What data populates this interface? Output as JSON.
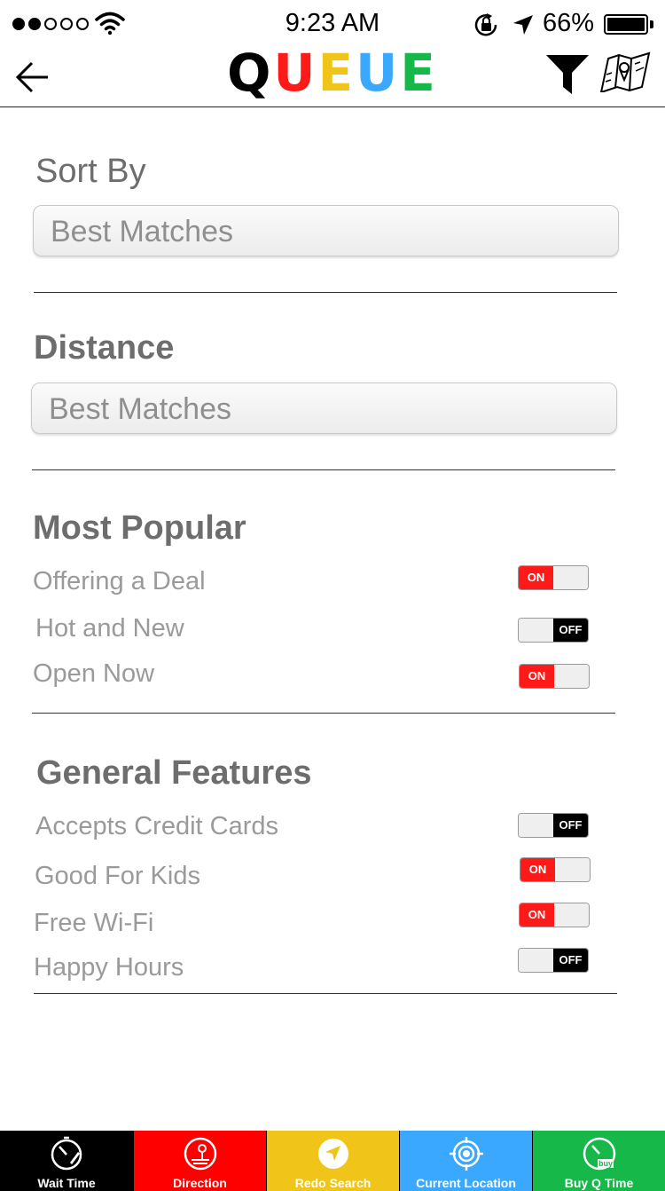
{
  "status_bar": {
    "signal_dots_filled": 2,
    "signal_dots_total": 5,
    "time": "9:23 AM",
    "battery_percent": "66%",
    "battery_level": 0.66
  },
  "nav": {
    "back_icon": "arrow-left-icon",
    "logo_letters": [
      {
        "char": "Q",
        "color": "#000000"
      },
      {
        "char": "U",
        "color": "#ff1a1a"
      },
      {
        "char": "E",
        "color": "#f0c419"
      },
      {
        "char": "U",
        "color": "#3aa8ff"
      },
      {
        "char": "E",
        "color": "#16b84a"
      }
    ],
    "filter_icon": "funnel-icon",
    "map_icon": "folded-map-icon"
  },
  "sort_by": {
    "heading": "Sort By",
    "value": "Best Matches"
  },
  "distance": {
    "heading": "Distance",
    "value": "Best Matches"
  },
  "most_popular": {
    "heading": "Most Popular",
    "items": [
      {
        "label": "Offering a Deal",
        "state": "ON"
      },
      {
        "label": "Hot and New",
        "state": "OFF"
      },
      {
        "label": "Open Now",
        "state": "ON"
      }
    ]
  },
  "general_features": {
    "heading": "General Features",
    "items": [
      {
        "label": "Accepts Credit Cards",
        "state": "OFF"
      },
      {
        "label": "Good For Kids",
        "state": "ON"
      },
      {
        "label": "Free Wi-Fi",
        "state": "ON"
      },
      {
        "label": "Happy Hours",
        "state": "OFF"
      }
    ]
  },
  "tab_bar": [
    {
      "label": "Wait Time",
      "icon": "stopwatch-icon",
      "color": "#000000"
    },
    {
      "label": "Direction",
      "icon": "direction-pin-icon",
      "color": "#ff0000"
    },
    {
      "label": "Redo Search",
      "icon": "navigation-arrow-icon",
      "color": "#f0c419"
    },
    {
      "label": "Current Location",
      "icon": "crosshair-icon",
      "color": "#3aa8ff"
    },
    {
      "label": "Buy Q Time",
      "icon": "buy-timer-icon",
      "color": "#16b84a"
    }
  ]
}
